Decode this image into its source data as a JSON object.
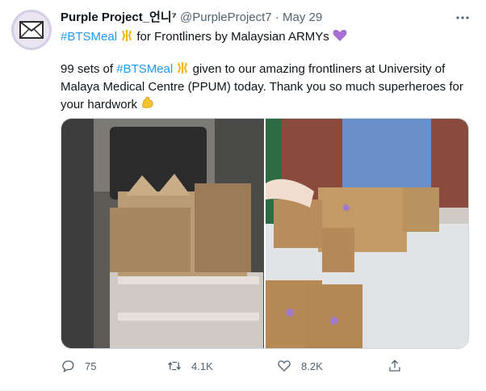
{
  "tweet": {
    "display_name": "Purple Project_언니⁷",
    "handle": "@PurpleProject7",
    "separator": "·",
    "date": "May 29",
    "line1": {
      "hashtag": "#BTSMeal",
      "text": "for Frontliners by Malaysian ARMYs"
    },
    "body": {
      "prefix": "99 sets of",
      "hashtag": "#BTSMeal",
      "text": "given to our amazing frontliners at University of Malaya Medical Centre (PPUM) today. Thank you so much superheroes for your hardwork"
    }
  },
  "actions": {
    "reply_count": "75",
    "retweet_count": "4.1K",
    "like_count": "8.2K"
  },
  "icons": {
    "avatar": "envelope-icon",
    "more": "more-icon",
    "reply": "reply-icon",
    "retweet": "retweet-icon",
    "like": "heart-icon",
    "share": "share-icon",
    "sparkle_emoji": "sparkles-emoji",
    "purple_heart": "purple-heart-emoji",
    "muscle": "flexed-biceps-emoji"
  },
  "colors": {
    "link": "#1d9bf0",
    "purple_heart": "#a56fd3",
    "muted": "#536471"
  }
}
